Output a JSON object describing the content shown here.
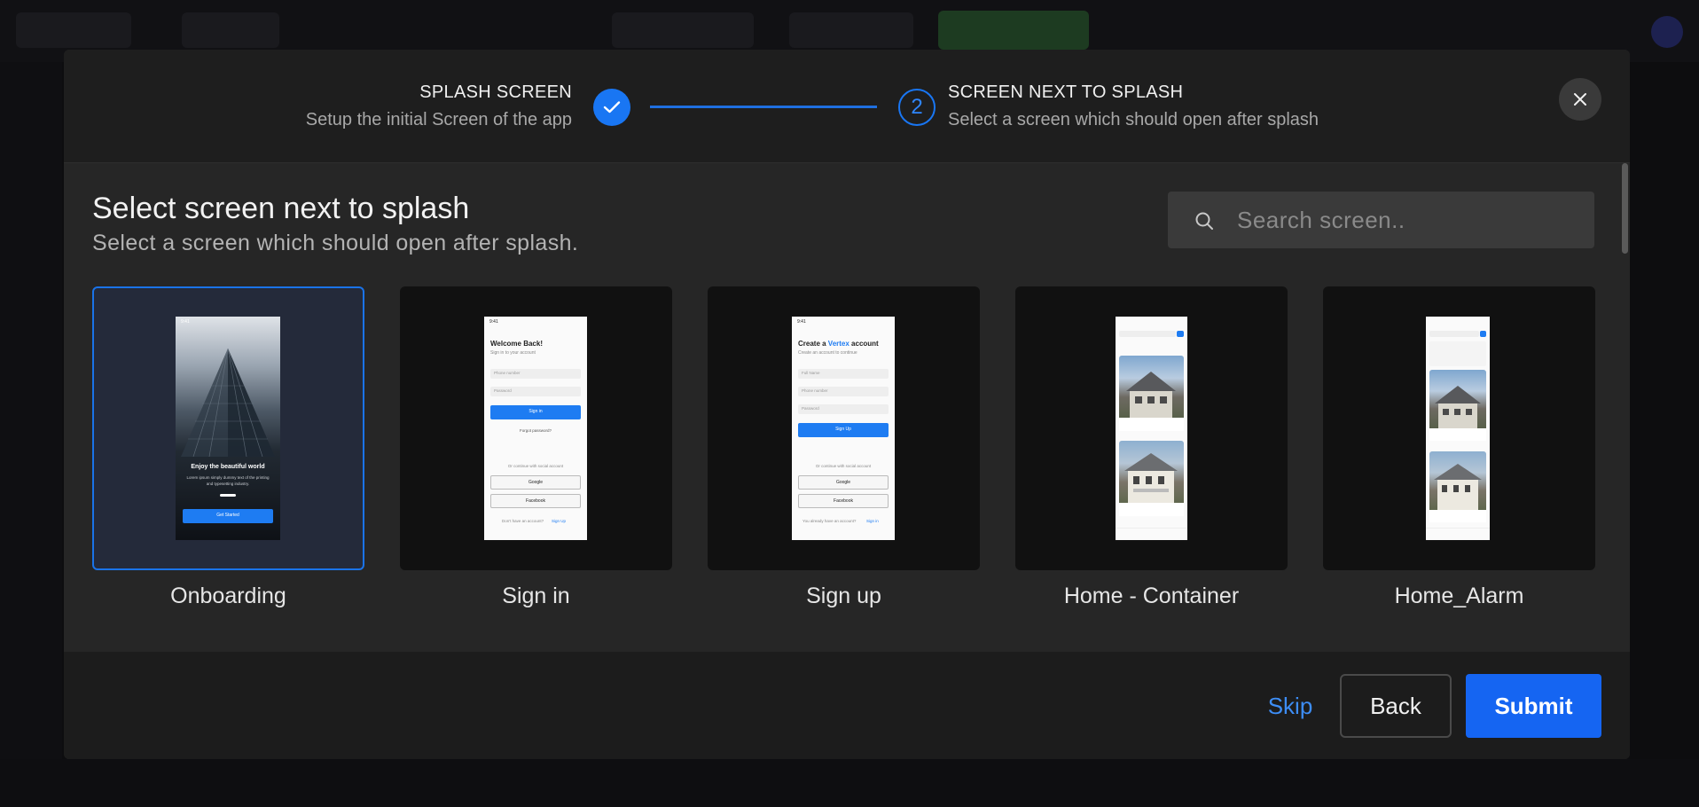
{
  "stepper": {
    "step1_title": "SPLASH SCREEN",
    "step1_subtitle": "Setup the initial Screen of the app",
    "step2_number": "2",
    "step2_title": "SCREEN NEXT TO SPLASH",
    "step2_subtitle": "Select a screen which should open after splash"
  },
  "content": {
    "title": "Select screen next to splash",
    "subtitle": "Select a screen which should open after splash.",
    "search_placeholder": "Search screen.."
  },
  "screens": [
    {
      "label": "Onboarding",
      "selected": true
    },
    {
      "label": "Sign in",
      "selected": false
    },
    {
      "label": "Sign up",
      "selected": false
    },
    {
      "label": "Home - Container",
      "selected": false
    },
    {
      "label": "Home_Alarm",
      "selected": false
    }
  ],
  "thumbs": {
    "onboarding": {
      "time": "9:41",
      "heading": "Enjoy the beautiful world",
      "body1": "Lorem ipsum simply dummy text of the printing",
      "body2": "and typesetting industry.",
      "cta": "Get Started"
    },
    "signin": {
      "time": "9:41",
      "heading": "Welcome Back!",
      "sub": "Sign in to your account",
      "field1": "Phone number",
      "field2": "Password",
      "cta": "Sign in",
      "forgot": "Forgot password?",
      "social": "Or continue with social account",
      "google": "Google",
      "facebook": "Facebook",
      "footer": "Don't have an account?",
      "footer_link": "Sign Up"
    },
    "signup": {
      "time": "9:41",
      "heading_a": "Create a ",
      "heading_brand": "Vertex",
      "heading_b": " account",
      "sub": "Create an account to continue",
      "field1": "Full Name",
      "field2": "Phone number",
      "field3": "Password",
      "cta": "Sign Up",
      "social": "Or continue with social account",
      "google": "Google",
      "facebook": "Facebook",
      "footer": "You already have an account?",
      "footer_link": "Sign in"
    }
  },
  "footer": {
    "skip": "Skip",
    "back": "Back",
    "submit": "Submit"
  },
  "colors": {
    "accent": "#1565f2",
    "selected_border": "#1a73e8"
  }
}
